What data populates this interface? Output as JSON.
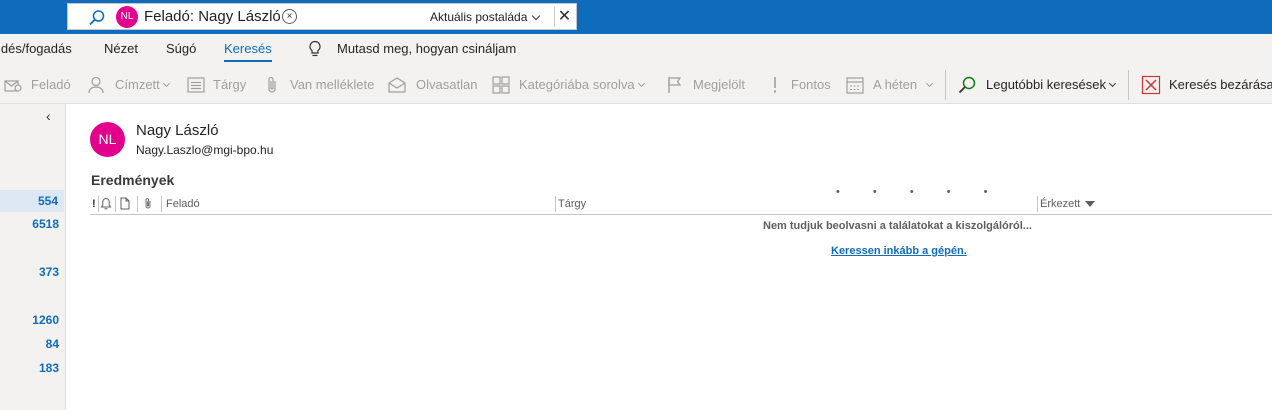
{
  "search": {
    "chip_initials": "NL",
    "chip_text": "Feladó: Nagy László",
    "chip_remove": "×",
    "scope": "Aktuális postaláda",
    "close": "✕"
  },
  "menu": {
    "items": [
      "ldés/fogadás",
      "Nézet",
      "Súgó",
      "Keresés"
    ],
    "active": "Keresés",
    "tell_me": "Mutasd meg, hogyan csináljam"
  },
  "toolbar": {
    "from": "Feladó",
    "to": "Címzett",
    "subject": "Tárgy",
    "has_attachment": "Van melléklete",
    "unread": "Olvasatlan",
    "categorized": "Kategóriába sorolva",
    "flagged": "Megjelölt",
    "important": "Fontos",
    "this_week": "A héten",
    "recent_searches": "Legutóbbi keresések",
    "close_search": "Keresés bezárása"
  },
  "left_pane": {
    "collapse": "‹",
    "counts": [
      "554",
      "6518",
      "373",
      "1260",
      "84",
      "183"
    ]
  },
  "contact": {
    "initials": "NL",
    "name": "Nagy László",
    "email": "Nagy.Laszlo@mgi-bpo.hu"
  },
  "results": {
    "title": "Eredmények",
    "loading_dots": "• • • • •",
    "columns": {
      "importance": "!",
      "from": "Feladó",
      "subject": "Tárgy",
      "received": "Érkezett"
    },
    "message": "Nem tudjuk beolvasni a találatokat a kiszolgálóról...",
    "link": "Keressen inkább a gépén."
  },
  "colors": {
    "accent": "#0f6cbd",
    "avatar": "#e3008c",
    "close_icon": "#d13438"
  }
}
